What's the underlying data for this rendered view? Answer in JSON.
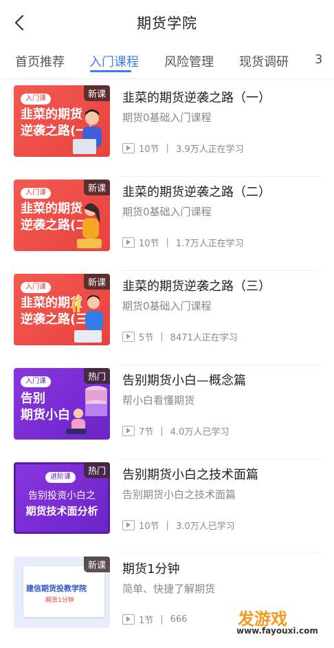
{
  "header": {
    "title": "期货学院"
  },
  "tabs": [
    {
      "label": "首页推荐"
    },
    {
      "label": "入门课程"
    },
    {
      "label": "风险管理"
    },
    {
      "label": "现货调研"
    },
    {
      "label": "3"
    }
  ],
  "courses": [
    {
      "badge": "新课",
      "thumb_tag": "入门课",
      "thumb_l1": "韭菜的期货",
      "thumb_l2": "逆袭之路(一)",
      "title": "韭菜的期货逆袭之路（一）",
      "subtitle": "期货0基础入门课程",
      "lessons": "10节",
      "learners": "3.9万人正在学习"
    },
    {
      "badge": "新课",
      "thumb_tag": "入门课",
      "thumb_l1": "韭菜的期货",
      "thumb_l2": "逆袭之路(二)",
      "title": "韭菜的期货逆袭之路（二）",
      "subtitle": "期货0基础入门课程",
      "lessons": "10节",
      "learners": "1.7万人正在学习"
    },
    {
      "badge": "新课",
      "thumb_tag": "入门课",
      "thumb_l1": "韭菜的期货",
      "thumb_l2": "逆袭之路(三)",
      "title": "韭菜的期货逆袭之路（三）",
      "subtitle": "期货0基础入门课程",
      "lessons": "5节",
      "learners": "8471人正在学习"
    },
    {
      "badge": "热门",
      "thumb_tag": "入门课",
      "thumb_l1": "告别",
      "thumb_l2": "期货小白",
      "title": "告别期货小白—概念篇",
      "subtitle": "帮小白看懂期货",
      "lessons": "7节",
      "learners": "4.0万人已学习"
    },
    {
      "badge": "热门",
      "thumb_tag": "进阶课",
      "thumb_l1": "告别投资小白之",
      "thumb_l2": "期货技术面分析",
      "title": "告别期货小白之技术面篇",
      "subtitle": "告别期货小白之技术面篇",
      "lessons": "10节",
      "learners": "3.0万人已学习"
    },
    {
      "badge": "新课",
      "thumb_tag": "",
      "thumb_l1": "建信期货投教学院",
      "thumb_l2": "期货1分钟",
      "title": "期货1分钟",
      "subtitle": "简单、快捷了解期货",
      "lessons": "1节",
      "learners": "666"
    }
  ],
  "watermark": {
    "brand": "发游戏",
    "url": "www.fayouxi.com"
  },
  "colors": {
    "accent": "#3a7ef0",
    "red_thumb": "#f0504a",
    "purple_thumb": "#7b2fd6",
    "blue_thumb": "#e7eefb"
  }
}
